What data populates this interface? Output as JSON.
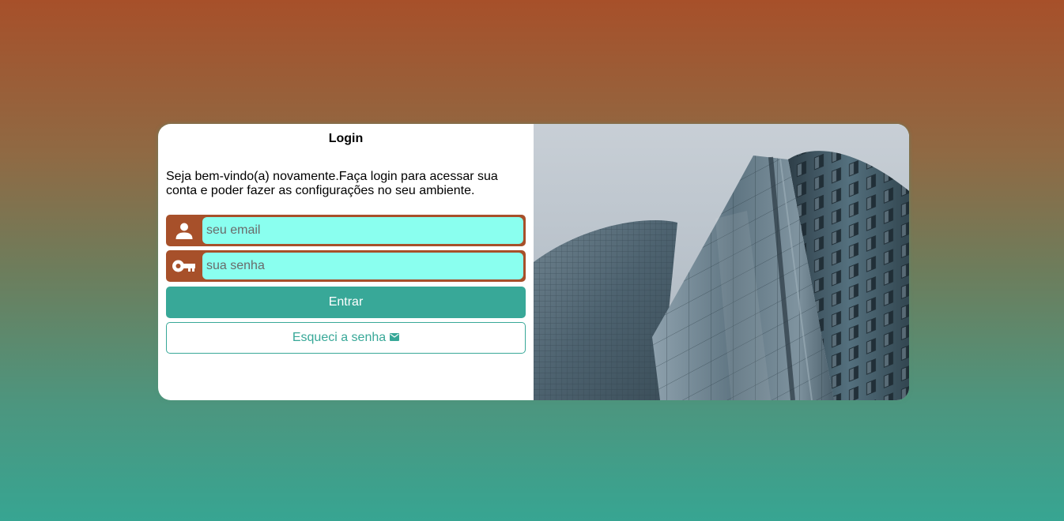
{
  "login": {
    "title": "Login",
    "description": "Seja bem-vindo(a) novamente.Faça login para acessar sua conta e poder fazer as configurações no seu ambiente.",
    "email": {
      "placeholder": "seu email",
      "value": "",
      "icon": "user-icon"
    },
    "password": {
      "placeholder": "sua senha",
      "value": "",
      "icon": "key-icon"
    },
    "submit_label": "Entrar",
    "forgot_label": "Esqueci a senha",
    "forgot_icon": "mail-icon"
  },
  "colors": {
    "accent": "#a7502a",
    "primary": "#38a898",
    "input_bg": "#8affef"
  },
  "hero_image": {
    "subject": "building-photo"
  }
}
